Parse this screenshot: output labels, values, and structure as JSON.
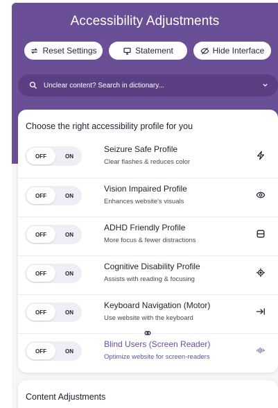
{
  "header": {
    "title": "Accessibility Adjustments",
    "buttons": [
      {
        "label": "Reset Settings",
        "icon": "reset-icon"
      },
      {
        "label": "Statement",
        "icon": "statement-icon"
      },
      {
        "label": "Hide Interface",
        "icon": "hide-icon"
      }
    ],
    "search": {
      "placeholder": "Unclear content? Search in dictionary..."
    }
  },
  "profiles": {
    "title": "Choose the right accessibility profile for you",
    "toggle_off": "OFF",
    "toggle_on": "ON",
    "items": [
      {
        "name": "Seizure Safe Profile",
        "desc": "Clear flashes & reduces color",
        "icon": "bolt-icon"
      },
      {
        "name": "Vision Impaired Profile",
        "desc": "Enhances website's visuals",
        "icon": "eye-icon"
      },
      {
        "name": "ADHD Friendly Profile",
        "desc": "More focus & fewer distractions",
        "icon": "focus-frame-icon"
      },
      {
        "name": "Cognitive Disability Profile",
        "desc": "Assists with reading & focusing",
        "icon": "target-icon"
      },
      {
        "name": "Keyboard Navigation (Motor)",
        "desc": "Use website with the keyboard",
        "icon": "arrow-to-bar-icon"
      },
      {
        "name": "Blind Users (Screen Reader)",
        "desc": "Optimize website for screen-readers",
        "icon": "audio-wave-icon"
      }
    ]
  },
  "content_adjustments": {
    "title": "Content Adjustments"
  },
  "colors": {
    "accent": "#6b4f96",
    "accent_dark": "#5a3f82",
    "background": "#f6f5f8"
  }
}
